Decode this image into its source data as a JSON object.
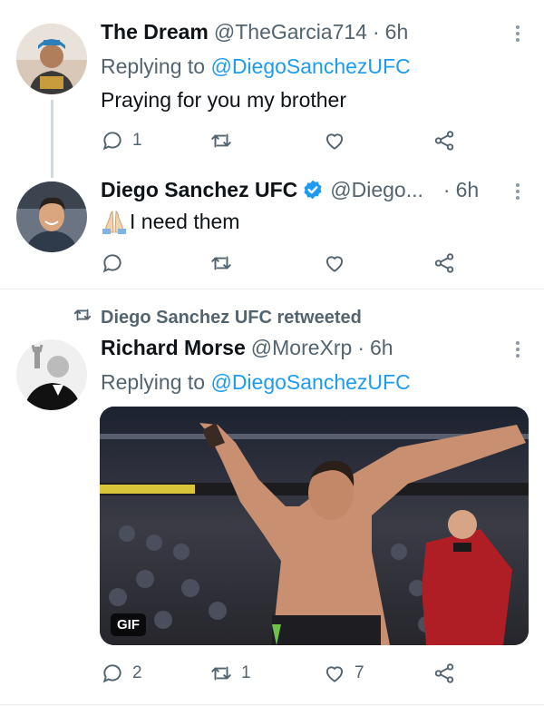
{
  "tweets": [
    {
      "name": "The Dream",
      "handle": "@TheGarcia714",
      "dot": "·",
      "time": "6h",
      "replying_prefix": "Replying to ",
      "replying_mention": "@DiegoSanchezUFC",
      "text": "Praying for you my brother",
      "reply_count": "1",
      "retweet_count": "",
      "like_count": ""
    },
    {
      "name": "Diego Sanchez UFC",
      "handle": "@Diego...",
      "dot": "·",
      "time": "6h",
      "text": "I need them",
      "emoji": "folded-hands",
      "verified": true,
      "reply_count": "",
      "retweet_count": "",
      "like_count": ""
    },
    {
      "retweeted_by": "Diego Sanchez UFC retweeted",
      "name": "Richard Morse",
      "handle": "@MoreXrp",
      "dot": "·",
      "time": "6h",
      "replying_prefix": "Replying to ",
      "replying_mention": "@DiegoSanchezUFC",
      "media_badge": "GIF",
      "reply_count": "2",
      "retweet_count": "1",
      "like_count": "7"
    }
  ],
  "colors": {
    "accent": "#1d9bf0",
    "secondary_text": "#536471",
    "primary_text": "#0f1419",
    "verified": "#1d9bf0"
  },
  "icons": [
    "reply-icon",
    "retweet-icon",
    "like-icon",
    "share-icon",
    "more-icon",
    "verified-icon"
  ]
}
